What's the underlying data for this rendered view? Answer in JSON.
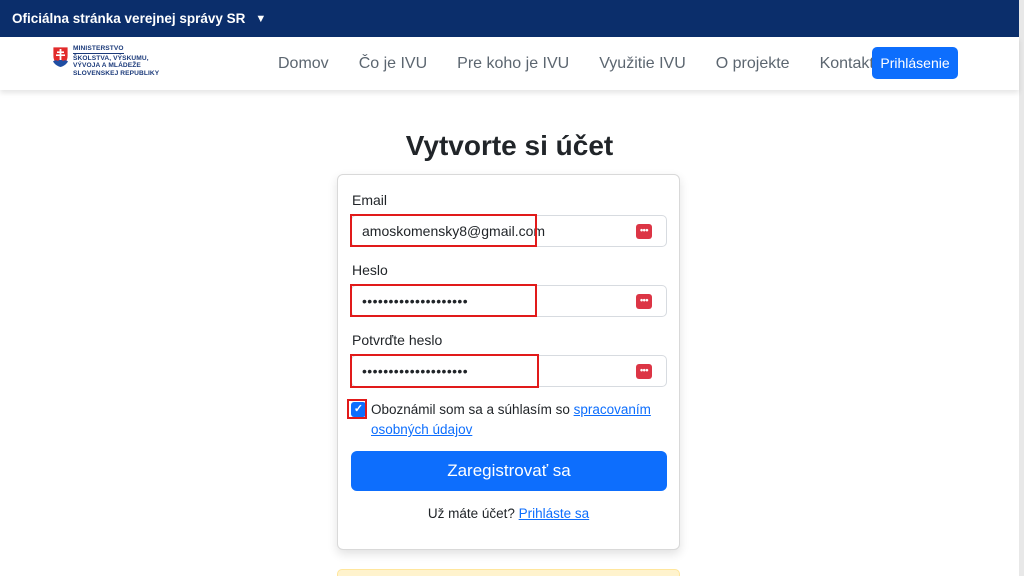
{
  "gov_bar": {
    "text": "Oficiálna stránka verejnej správy SR",
    "caret": "▼"
  },
  "logo": {
    "line1": "MINISTERSTVO",
    "line2": "ŠKOLSTVA, VÝSKUMU,",
    "line3": "VÝVOJA A MLÁDEŽE",
    "line4": "SLOVENSKEJ REPUBLIKY"
  },
  "nav": {
    "items": [
      "Domov",
      "Čo je IVU",
      "Pre koho je IVU",
      "Využitie IVU",
      "O projekte",
      "Kontakt"
    ],
    "login_label": "Prihlásenie"
  },
  "page_title": "Vytvorte si účet",
  "form": {
    "email_label": "Email",
    "email_value": "amoskomensky8@gmail.com",
    "password_label": "Heslo",
    "password_value": "••••••••••••••••••••",
    "confirm_label": "Potvrďte heslo",
    "confirm_value": "••••••••••••••••••••",
    "password_manager_icon": "•••",
    "consent_checked": true,
    "consent_text": "Oboznámil som sa a súhlasím so ",
    "consent_link": "spracovaním osobných údajov",
    "submit_label": "Zaregistrovať sa",
    "login_prompt": "Už máte účet? ",
    "login_link": "Prihláste sa"
  },
  "colors": {
    "gov_bar": "#0b2e6b",
    "primary": "#0d6efd",
    "highlight": "#e11a1a",
    "pm_icon": "#dc3545"
  }
}
